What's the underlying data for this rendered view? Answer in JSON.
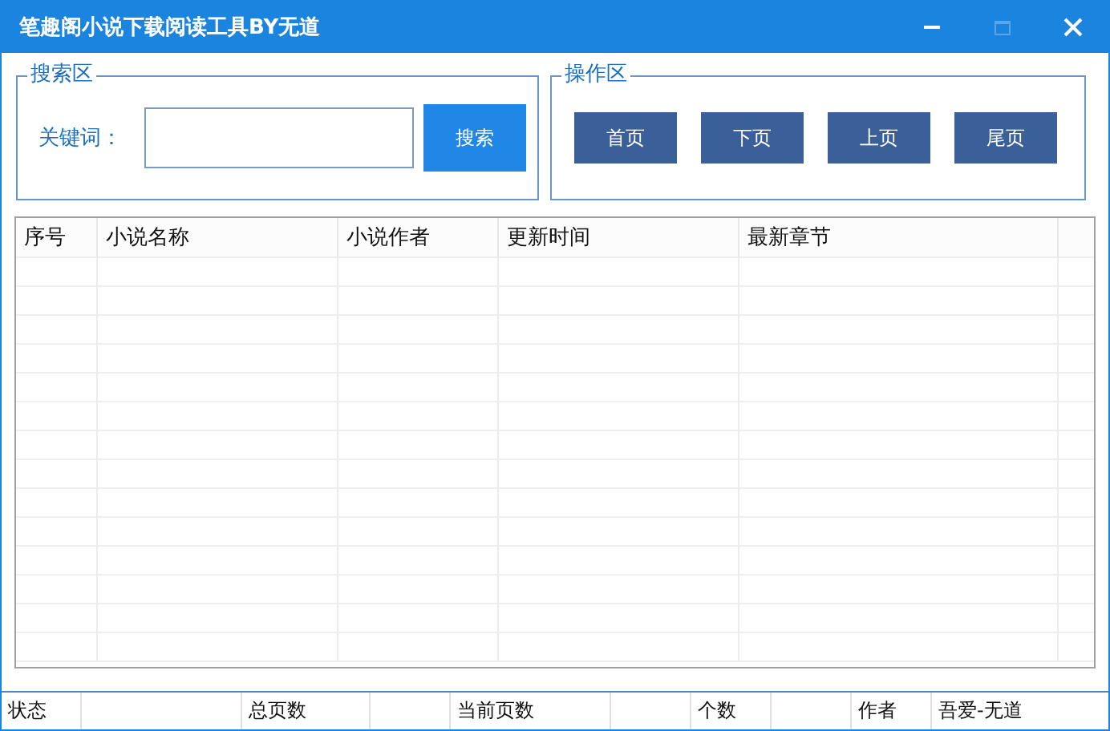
{
  "window": {
    "title": "笔趣阁小说下载阅读工具BY无道",
    "maximize_disabled": true
  },
  "search_group": {
    "title": "搜索区",
    "label": "关键词：",
    "button": "搜索"
  },
  "action_group": {
    "title": "操作区",
    "buttons": [
      "首页",
      "下页",
      "上页",
      "尾页"
    ]
  },
  "table": {
    "columns": [
      "序号",
      "小说名称",
      "小说作者",
      "更新时间",
      "最新章节"
    ]
  },
  "status_bar": [
    {
      "label": "状态"
    },
    {
      "label": "总页数"
    },
    {
      "label": "当前页数"
    },
    {
      "label": "个数"
    },
    {
      "label": "作者",
      "value": "吾爱-无道"
    }
  ]
}
